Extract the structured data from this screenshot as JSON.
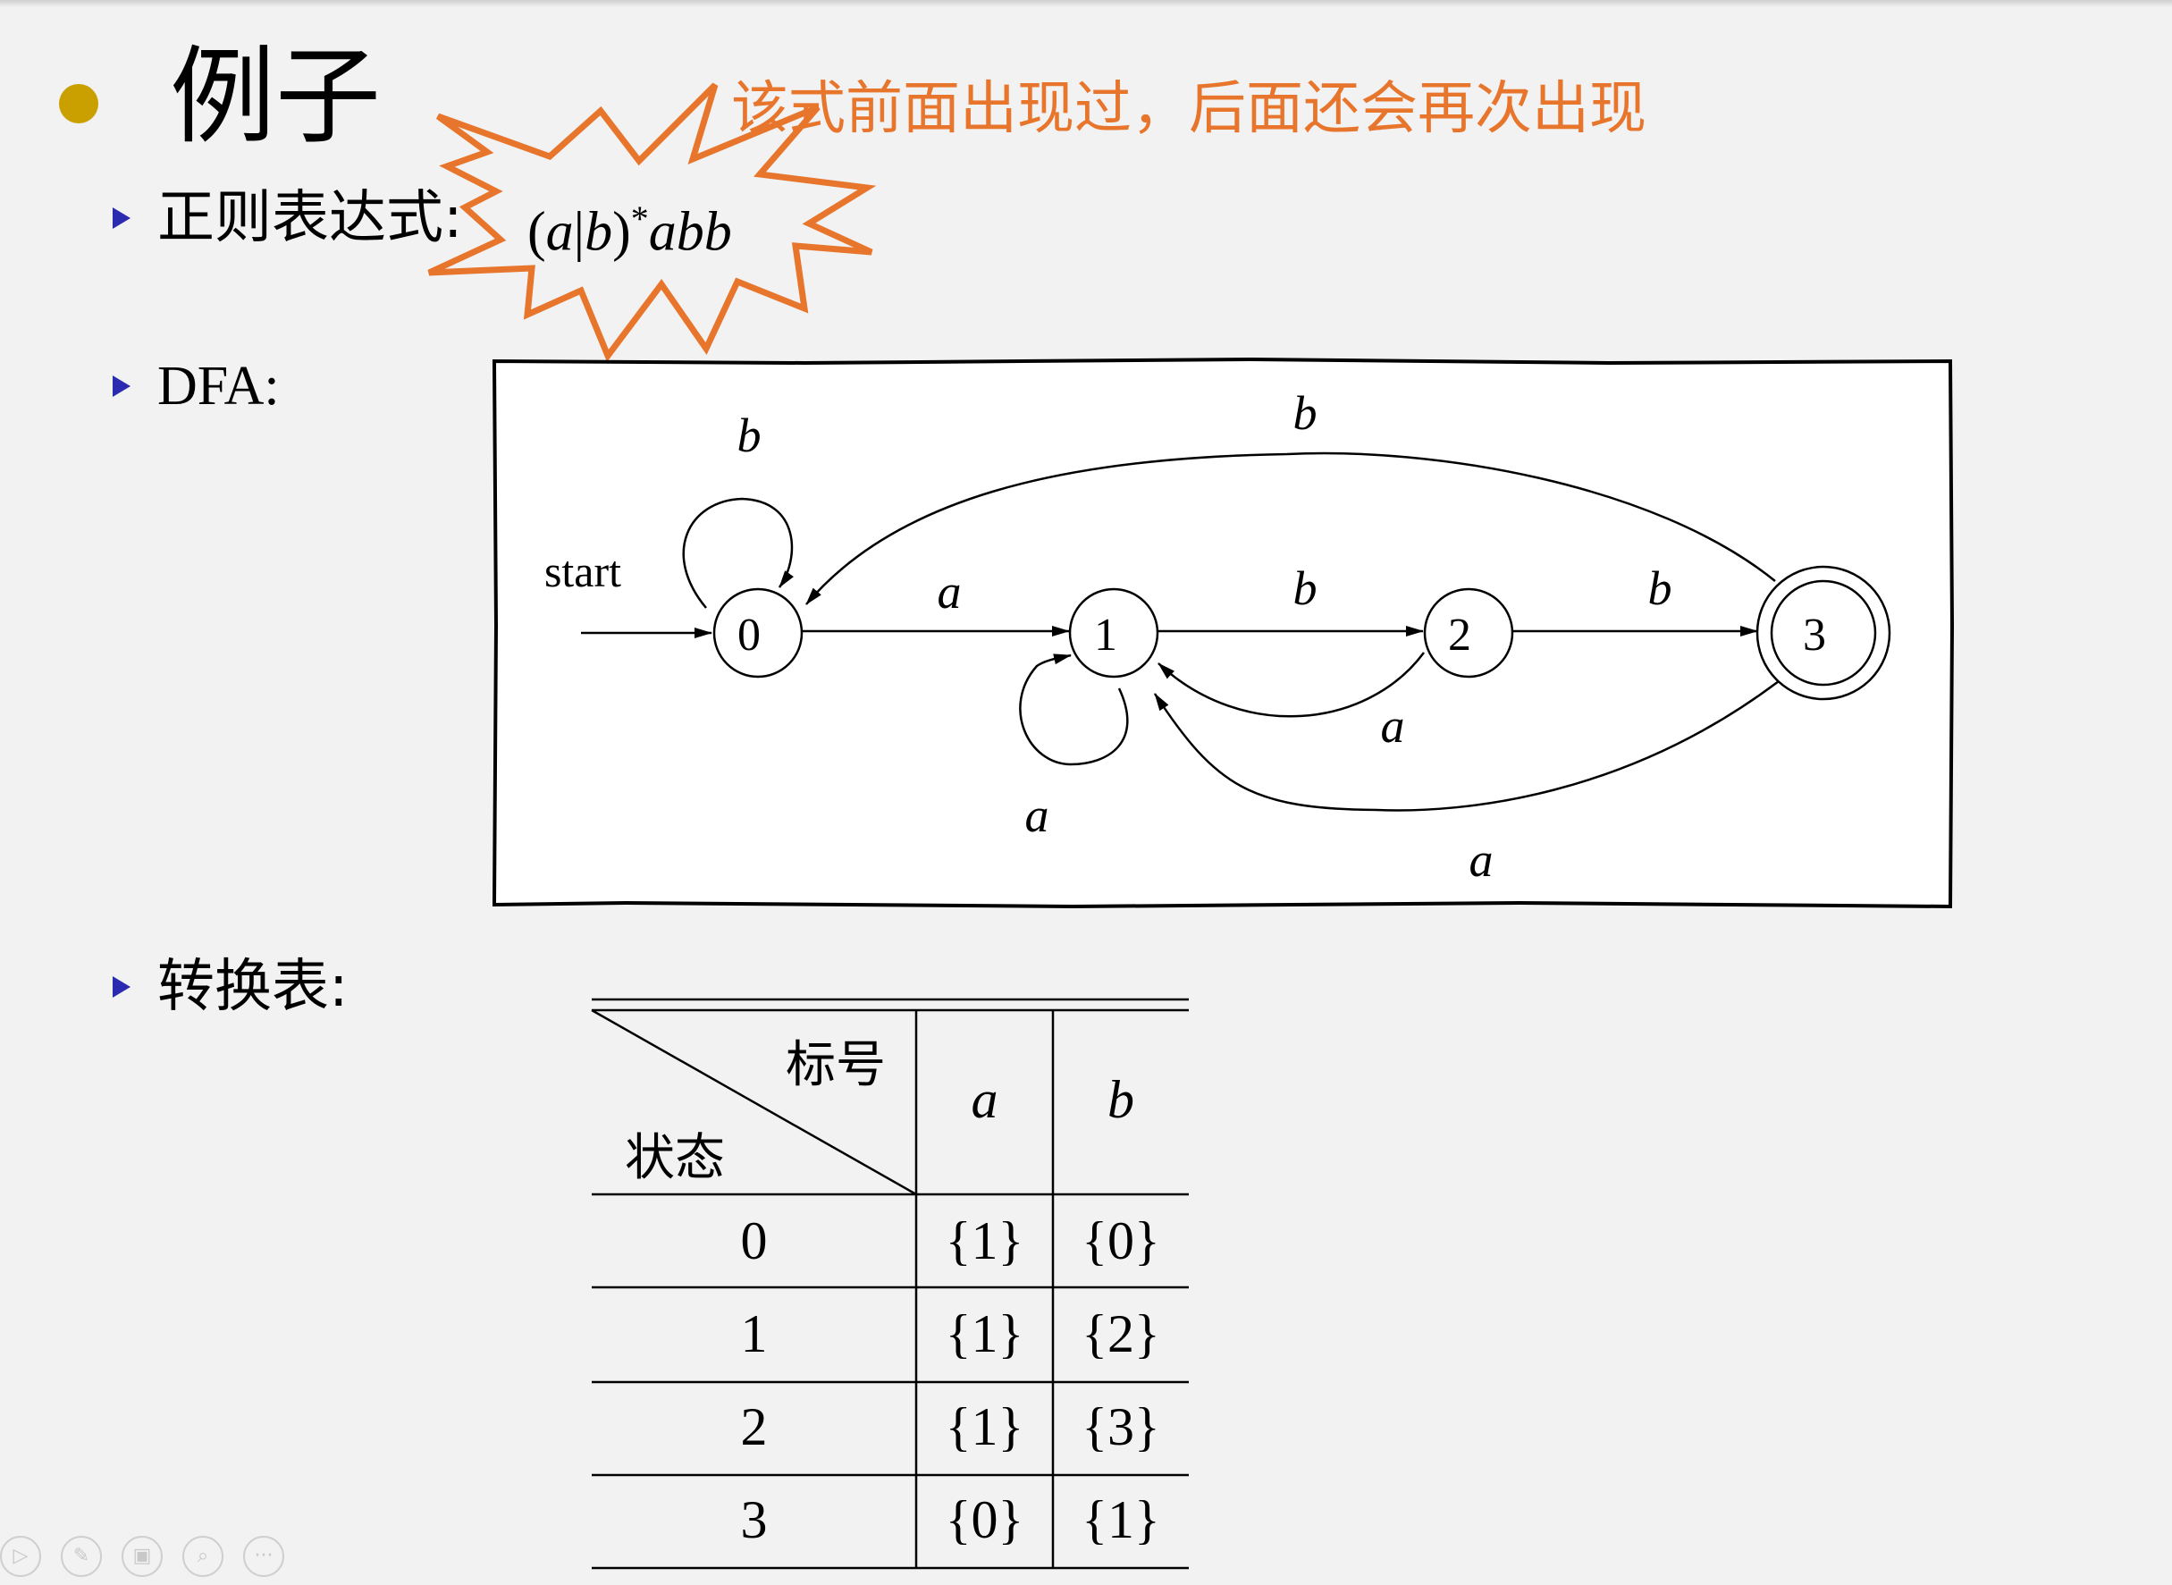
{
  "slide": {
    "title": "例子",
    "callout": "该式前面出现过，后面还会再次出现",
    "items": {
      "regex_label": "正则表达式:",
      "dfa_label": "DFA:",
      "table_label": "转换表:"
    },
    "regex": {
      "open": "(",
      "a": "a",
      "bar": "|",
      "b": "b",
      "close": ")",
      "star": "*",
      "tail": "abb"
    }
  },
  "dfa": {
    "start_label": "start",
    "states": [
      "0",
      "1",
      "2",
      "3"
    ],
    "accepting": [
      "3"
    ],
    "edge_labels": {
      "loop0": "b",
      "e01": "a",
      "e12": "b",
      "e23": "b",
      "e30": "b",
      "loop1": "a",
      "e21": "a",
      "e31": "a"
    }
  },
  "table": {
    "header_top": "标号",
    "header_bottom": "状态",
    "columns": [
      "a",
      "b"
    ],
    "rows": [
      {
        "state": "0",
        "a": "{1}",
        "b": "{0}"
      },
      {
        "state": "1",
        "a": "{1}",
        "b": "{2}"
      },
      {
        "state": "2",
        "a": "{1}",
        "b": "{3}"
      },
      {
        "state": "3",
        "a": "{0}",
        "b": "{1}"
      }
    ]
  },
  "footer": {
    "icons": [
      "play-icon",
      "pen-icon",
      "slides-icon",
      "zoom-icon",
      "more-icon"
    ],
    "glyphs": [
      "▷",
      "✎",
      "▣",
      "⌕",
      "···"
    ]
  }
}
